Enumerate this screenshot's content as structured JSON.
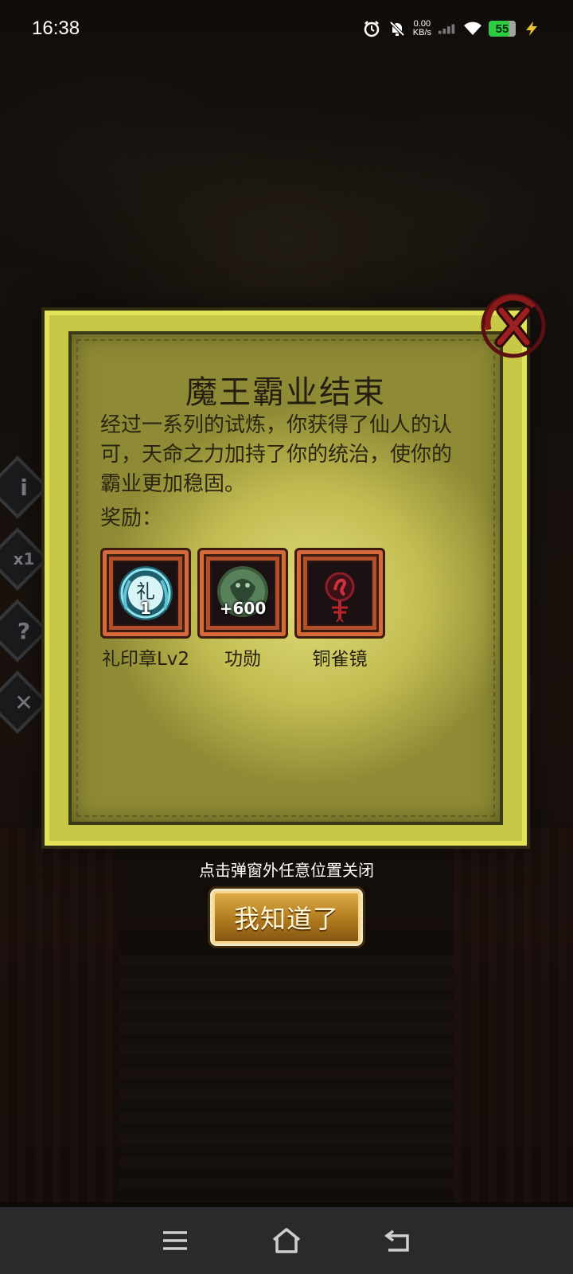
{
  "status_bar": {
    "time": "16:38",
    "net_speed_value": "0.00",
    "net_speed_unit": "KB/s",
    "battery": "55"
  },
  "dialog": {
    "title": "魔王霸业结束",
    "description": "经过一系列的试炼，你获得了仙人的认可，天命之力加持了你的统治，使你的霸业更加稳固。",
    "reward_label": "奖励：",
    "rewards": [
      {
        "name": "礼印章Lv2",
        "count": "1",
        "icon": "seal-icon",
        "glyph": "礼"
      },
      {
        "name": "功勋",
        "count": "+600",
        "icon": "merit-medal-icon"
      },
      {
        "name": "铜雀镜",
        "count": "",
        "icon": "bronze-mirror-icon"
      }
    ]
  },
  "side_buttons": [
    "info-icon",
    "speed-icon",
    "help-icon",
    "tools-icon"
  ],
  "side_speed_label": "x1",
  "hint": "点击弹窗外任意位置关闭",
  "confirm_button": "我知道了",
  "colors": {
    "dialog_bg": "#c8c847",
    "dialog_border": "#e3e35a",
    "reward_frame": "#b2502c",
    "button_gold": "#c08a2a",
    "close_red": "#8a1a1a"
  }
}
